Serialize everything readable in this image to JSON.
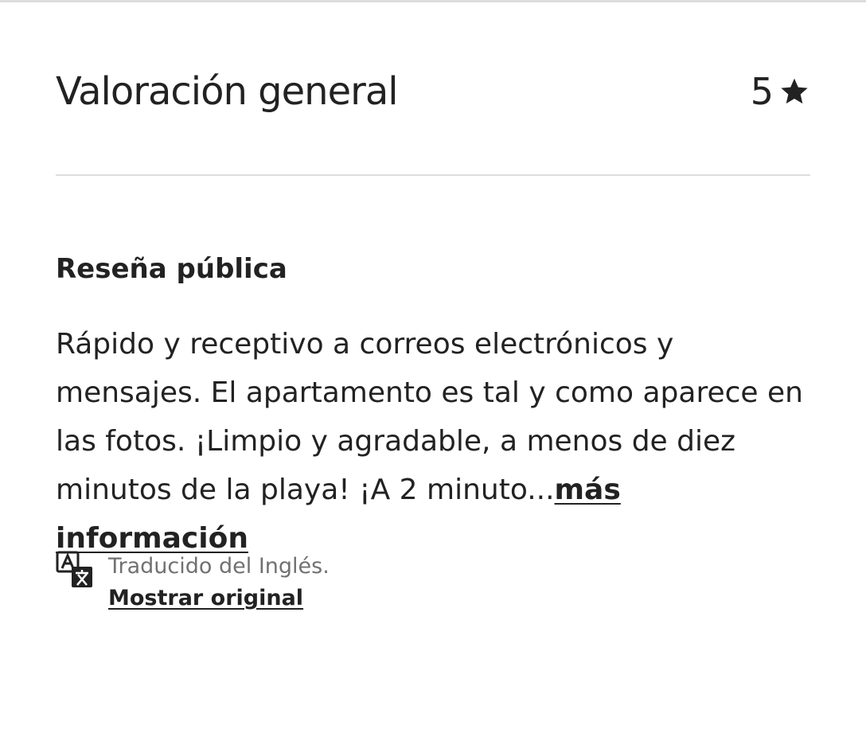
{
  "rating": {
    "title": "Valoración general",
    "value": "5",
    "icon": "star-icon"
  },
  "review": {
    "section_title": "Reseña pública",
    "text": "Rápido y receptivo a correos electrónicos y mensajes. El apartamento es tal y como aparece en las fotos. ¡Limpio y agradable, a menos de diez minutos de la playa! ¡A 2 minuto...",
    "more_label": "más información"
  },
  "translation": {
    "icon": "translate-icon",
    "note": "Traducido del Inglés.",
    "show_original_label": "Mostrar original"
  },
  "colors": {
    "text": "#222222",
    "muted": "#717171",
    "divider": "#dddddd"
  }
}
